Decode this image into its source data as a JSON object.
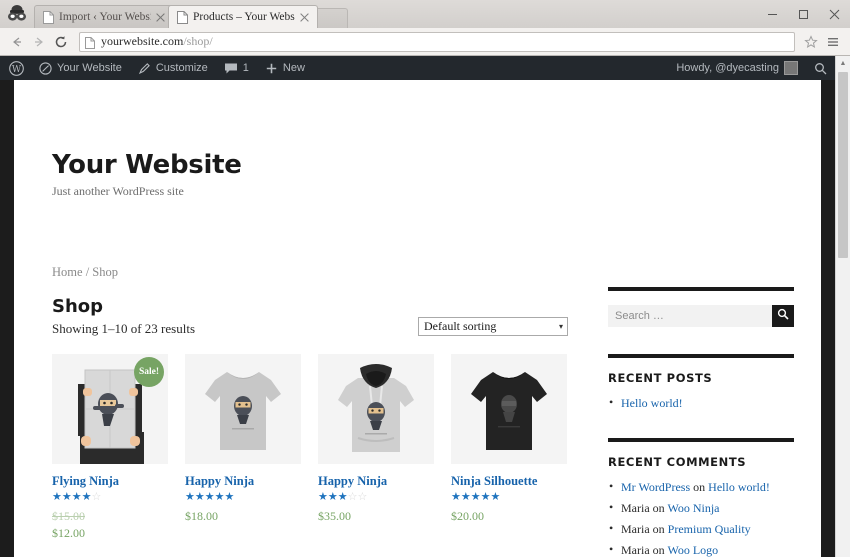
{
  "browser": {
    "incognito_icon": "incognito-icon",
    "tabs": [
      {
        "title": "Import ‹ Your Website — ",
        "active": false,
        "favicon": "page-icon",
        "close": "close-icon"
      },
      {
        "title": "Products – Your Website",
        "active": true,
        "favicon": "page-icon",
        "close": "close-icon"
      }
    ],
    "window_controls": {
      "minimize": "–",
      "maximize": "□",
      "close": "✕"
    },
    "nav": {
      "back": "←",
      "forward": "→",
      "reload": "⟳"
    },
    "omnibox": {
      "host": "yourwebsite.com",
      "path": "/shop/",
      "icon": "page-icon"
    },
    "bookmark_icon": "star-icon",
    "menu_icon": "hamburger-menu-icon"
  },
  "adminbar": {
    "logo": "wordpress-logo-icon",
    "site_name": "Your Website",
    "site_icon": "dashboard-icon",
    "customize": "Customize",
    "customize_icon": "pencil-icon",
    "comments_count": "1",
    "comments_icon": "comment-bubble-icon",
    "new": "New",
    "new_icon": "plus-icon",
    "howdy": "Howdy, @dyecasting",
    "avatar": "user-avatar",
    "search_icon": "search-icon"
  },
  "site": {
    "title": "Your Website",
    "tagline": "Just another WordPress site"
  },
  "shop": {
    "breadcrumb": {
      "home": "Home",
      "separator": "/",
      "current": "Shop"
    },
    "title": "Shop",
    "result_count": "Showing 1–10 of 23 results",
    "sorting": {
      "selected": "Default sorting",
      "caret": "▾"
    },
    "sale_badge": "Sale!",
    "products": [
      {
        "name": "Flying Ninja",
        "rating": 4,
        "rating_max": 5,
        "on_sale": true,
        "regular_price": "$15.00",
        "sale_price": "$12.00",
        "art": "poster-held-by-person"
      },
      {
        "name": "Happy Ninja",
        "rating": 5,
        "rating_max": 5,
        "on_sale": false,
        "price": "$18.00",
        "art": "grey-tshirt"
      },
      {
        "name": "Happy Ninja",
        "rating": 3,
        "rating_max": 5,
        "on_sale": false,
        "price": "$35.00",
        "art": "grey-hoodie"
      },
      {
        "name": "Ninja Silhouette",
        "rating": 5,
        "rating_max": 5,
        "on_sale": false,
        "price": "$20.00",
        "art": "black-tshirt"
      }
    ]
  },
  "sidebar": {
    "search": {
      "placeholder": "Search …",
      "button_icon": "search-icon"
    },
    "recent_posts": {
      "title": "RECENT POSTS",
      "items": [
        {
          "label": "Hello world!"
        }
      ]
    },
    "recent_comments": {
      "title": "RECENT COMMENTS",
      "items": [
        {
          "author": "Mr WordPress",
          "on": "on",
          "post": "Hello world!"
        },
        {
          "author": "Maria",
          "on": "on",
          "post": "Woo Ninja"
        },
        {
          "author": "Maria",
          "on": "on",
          "post": "Premium Quality"
        },
        {
          "author": "Maria",
          "on": "on",
          "post": "Woo Logo"
        }
      ]
    }
  },
  "colors": {
    "link": "#1763ab",
    "price": "#77a464",
    "star": "#1e73be",
    "admin_bar": "#23282d",
    "sale_badge": "#77a464"
  }
}
